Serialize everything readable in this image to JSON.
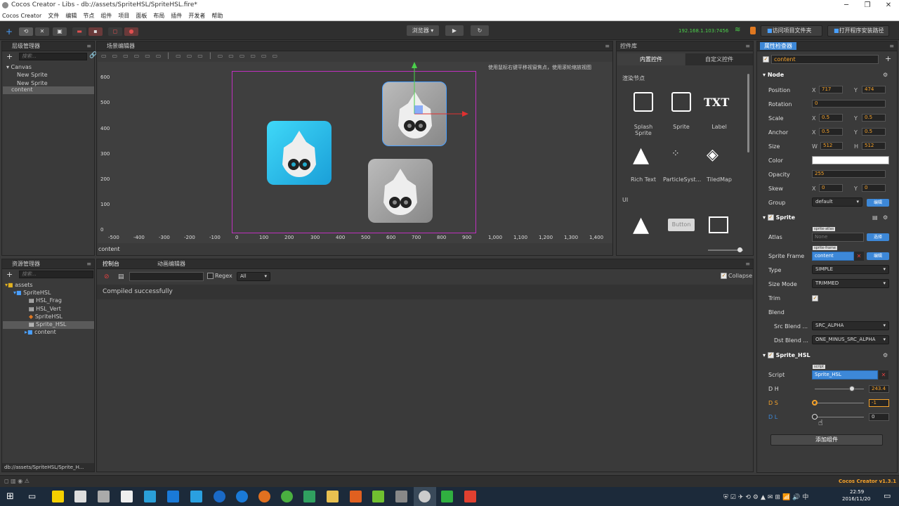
{
  "window": {
    "title": "Cocos Creator - Libs - db://assets/SpriteHSL/SpriteHSL.fire*",
    "min": "─",
    "max": "❐",
    "close": "✕"
  },
  "menu": [
    "Cocos Creator",
    "文件",
    "编辑",
    "节点",
    "组件",
    "项目",
    "面板",
    "布局",
    "插件",
    "开发者",
    "帮助"
  ],
  "toolbar": {
    "browser_label": "浏览器 ▾",
    "play": "▶",
    "refresh": "↻",
    "ip": "192.168.1.103:7456",
    "open_project": "访问项目文件夹",
    "open_install": "打开程序安装路径"
  },
  "hierarchy": {
    "title": "层级管理器",
    "search": "搜索...",
    "items": [
      "▾ Canvas",
      "New Sprite",
      "New Sprite",
      "content"
    ]
  },
  "scene": {
    "title": "场景编辑器",
    "hint": "使用鼠标右键平移视窗焦点，使用滚轮缩放视图",
    "node_label": "content",
    "yticks": [
      "600",
      "500",
      "400",
      "300",
      "200",
      "100",
      "0"
    ],
    "xticks": [
      "-500",
      "-400",
      "-300",
      "-200",
      "-100",
      "0",
      "100",
      "200",
      "300",
      "400",
      "500",
      "600",
      "700",
      "800",
      "900",
      "1,000",
      "1,100",
      "1,200",
      "1,300",
      "1,400"
    ]
  },
  "widgets": {
    "title": "控件库",
    "tab_builtin": "内置控件",
    "tab_custom": "自定义控件",
    "section_render": "渲染节点",
    "section_ui": "UI",
    "items": [
      "Splash Sprite",
      "Sprite",
      "Label",
      "Rich Text",
      "ParticleSyst...",
      "TiledMap"
    ],
    "txt_glyph": "TXT",
    "button_glyph": "Button"
  },
  "assets": {
    "title": "资源管理器",
    "search": "搜索...",
    "items": [
      "assets",
      "SpriteHSL",
      "HSL_Frag",
      "HSL_Vert",
      "SpriteHSL",
      "Sprite_HSL",
      "content"
    ],
    "path": "db://assets/SpriteHSL/Sprite_H..."
  },
  "console": {
    "tab_console": "控制台",
    "tab_anim": "动画编辑器",
    "regex": "Regex",
    "filter": "All",
    "collapse": "Collapse",
    "message": "Compiled successfully"
  },
  "inspector": {
    "title": "属性检查器",
    "node_name": "content",
    "node_section": "Node",
    "position": {
      "label": "Position",
      "x": "717",
      "y": "474"
    },
    "rotation": {
      "label": "Rotation",
      "value": "0"
    },
    "scale": {
      "label": "Scale",
      "x": "0.5",
      "y": "0.5"
    },
    "anchor": {
      "label": "Anchor",
      "x": "0.5",
      "y": "0.5"
    },
    "size": {
      "label": "Size",
      "w": "512",
      "h": "512"
    },
    "color": {
      "label": "Color",
      "value": "#ffffff"
    },
    "opacity": {
      "label": "Opacity",
      "value": "255"
    },
    "skew": {
      "label": "Skew",
      "x": "0",
      "y": "0"
    },
    "group": {
      "label": "Group",
      "value": "default",
      "btn": "编辑"
    },
    "sprite_section": "Sprite",
    "atlas": {
      "label": "Atlas",
      "tag": "sprite-atlas",
      "value": "None",
      "btn": "选择"
    },
    "sprite_frame": {
      "label": "Sprite Frame",
      "tag": "sprite-frame",
      "value": "content",
      "btn": "编辑"
    },
    "type": {
      "label": "Type",
      "value": "SIMPLE"
    },
    "size_mode": {
      "label": "Size Mode",
      "value": "TRIMMED"
    },
    "trim": {
      "label": "Trim"
    },
    "blend": {
      "label": "Blend"
    },
    "src_blend": {
      "label": "Src Blend ...",
      "value": "SRC_ALPHA"
    },
    "dst_blend": {
      "label": "Dst Blend ...",
      "value": "ONE_MINUS_SRC_ALPHA"
    },
    "hsl_section": "Sprite_HSL",
    "script": {
      "label": "Script",
      "tag": "script",
      "value": "Sprite_HSL"
    },
    "dh": {
      "label": "D H",
      "value": "243.4",
      "level": 0.75
    },
    "ds": {
      "label": "D S",
      "value": "-1",
      "level": 0
    },
    "dl": {
      "label": "D L",
      "value": "0",
      "level": 0
    },
    "add_component": "添加组件",
    "version": "Cocos Creator v1.3.1"
  },
  "labels": {
    "x": "X",
    "y": "Y",
    "w": "W",
    "h": "H"
  },
  "taskbar": {
    "time": "22:59",
    "date": "2016/11/20"
  },
  "colors": {
    "accent": "#3d88d8",
    "value_orange": "#f7a32a",
    "selection_magenta": "#c030c0"
  }
}
